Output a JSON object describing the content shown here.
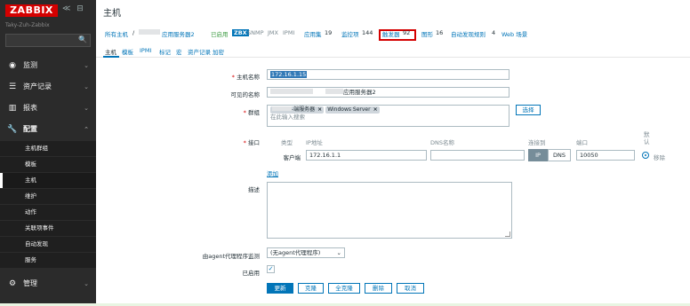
{
  "sidebar": {
    "logo": "ZABBIX",
    "collapse": "≪",
    "kiosk": "⊟",
    "server": "Taky-Zuh-Zabbix",
    "search_icon": "🔍",
    "menu": [
      {
        "label": "监测",
        "icon": "eye-icon"
      },
      {
        "label": "资产记录",
        "icon": "list-icon"
      },
      {
        "label": "报表",
        "icon": "chart-icon"
      },
      {
        "label": "配置",
        "icon": "wrench-icon"
      },
      {
        "label": "管理",
        "icon": "gear-icon"
      }
    ],
    "submenu": [
      "主机群组",
      "模板",
      "主机",
      "维护",
      "动作",
      "关联项事件",
      "自动发现",
      "服务"
    ]
  },
  "page": {
    "title": "主机"
  },
  "crumbs": {
    "all_hosts": "所有主机",
    "sep": "/",
    "host": "应用服务器2",
    "enabled": "已启用",
    "zbx": "ZBX",
    "snmp": "SNMP",
    "jmx": "JMX",
    "ipmi": "IPMI",
    "apps": "应用集",
    "apps_n": "19",
    "items": "监控项",
    "items_n": "144",
    "triggers": "触发器",
    "triggers_n": "92",
    "graphs": "图形",
    "graphs_n": "16",
    "discovery": "自动发现规则",
    "discovery_n": "4",
    "web": "Web 场景"
  },
  "tabs": [
    "主机",
    "模板",
    "IPMI",
    "标记",
    "宏",
    "资产记录",
    "加密"
  ],
  "form": {
    "host_name_label": "主机名称",
    "host_name_value": "172.16.1.15",
    "visible_name_label": "可见的名称",
    "visible_name_value": "应用服务器2",
    "groups_label": "群组",
    "group1": "-端服务器",
    "group2": "Windows Server",
    "group_remove": "×",
    "groups_placeholder": "在此输入搜索",
    "select_button": "选择",
    "iface_label": "接口",
    "col_type": "类型",
    "col_ip": "IP地址",
    "col_dns": "DNS名称",
    "col_connect": "连接到",
    "col_port": "端口",
    "col_default": "默认",
    "agent_label": "客户端",
    "agent_ip": "172.16.1.1",
    "ip_btn": "IP",
    "dns_btn": "DNS",
    "port": "10050",
    "remove": "移除",
    "add": "添加",
    "desc_label": "描述",
    "proxy_label": "由agent代理程序监测",
    "proxy_value": "(无agent代理程序)",
    "enabled_label": "已启用",
    "check": "✓"
  },
  "buttons": {
    "update": "更新",
    "clone": "克隆",
    "full_clone": "全克隆",
    "delete": "删除",
    "cancel": "取消"
  }
}
